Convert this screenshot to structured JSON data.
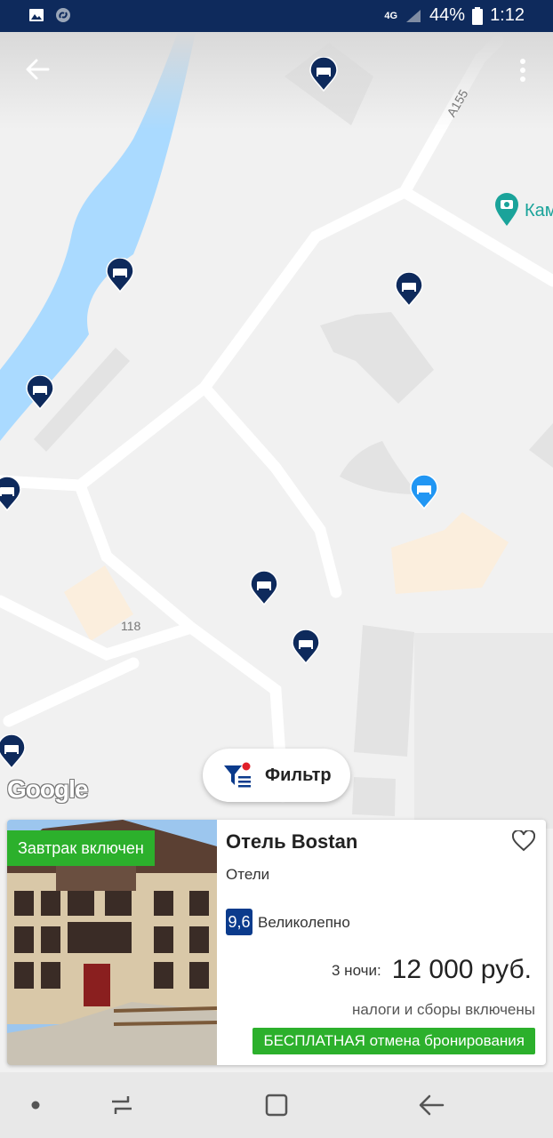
{
  "status_bar": {
    "network": "4G",
    "battery": "44%",
    "time": "1:12",
    "icons": [
      "image-icon",
      "shazam-icon",
      "signal-icon",
      "battery-icon"
    ]
  },
  "map": {
    "poi_label": "Кам",
    "road_label_a": "A155",
    "road_label_b": "118",
    "logo_text": "Google",
    "filter_label": "Фильтр",
    "icons": [
      "back-arrow-icon",
      "more-vert-icon",
      "bed-pin-icon",
      "camera-pin-icon",
      "filter-icon"
    ]
  },
  "hotel_card": {
    "badge": "Завтрак включен",
    "name": "Отель Bostan",
    "type": "Отели",
    "score": "9,6",
    "score_text": "Великолепно",
    "nights_label": "3 ночи:",
    "price": "12 000 руб.",
    "taxes": "налоги и сборы включены",
    "cancellation": "БЕСПЛАТНАЯ отмена бронирования",
    "colors": {
      "badge": "#2cb02c",
      "score": "#0b3b8c"
    }
  },
  "nav_bar": {
    "icons": [
      "dot-icon",
      "recents-icon",
      "home-icon",
      "back-icon"
    ]
  }
}
